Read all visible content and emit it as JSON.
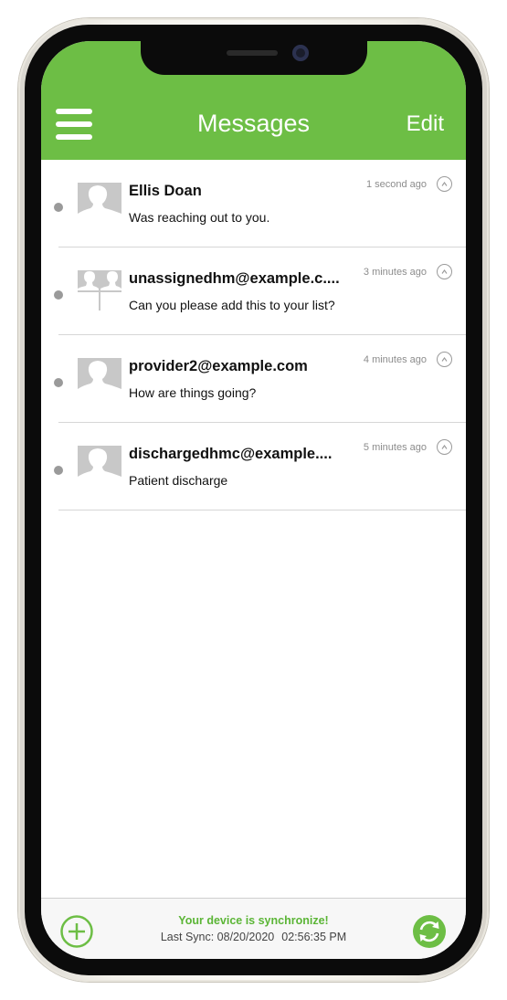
{
  "header": {
    "title": "Messages",
    "edit_label": "Edit",
    "menu_icon": "hamburger-menu-icon"
  },
  "messages": [
    {
      "name": "Ellis Doan",
      "preview": "Was reaching out to you.",
      "time": "1 second ago",
      "avatar": "single"
    },
    {
      "name": "unassignedhm@example.c....",
      "preview": "Can you please add this to your list?",
      "time": "3 minutes ago",
      "avatar": "group"
    },
    {
      "name": "provider2@example.com",
      "preview": "How are things going?",
      "time": "4 minutes ago",
      "avatar": "single"
    },
    {
      "name": "dischargedhmc@example....",
      "preview": "Patient discharge",
      "time": "5 minutes ago",
      "avatar": "single"
    }
  ],
  "footer": {
    "sync_status": "Your device is synchronize!",
    "last_sync_label": "Last Sync: 08/20/2020",
    "last_sync_time": "02:56:35 PM"
  },
  "colors": {
    "brand_green": "#6dbe45",
    "sync_green": "#5bb536"
  }
}
